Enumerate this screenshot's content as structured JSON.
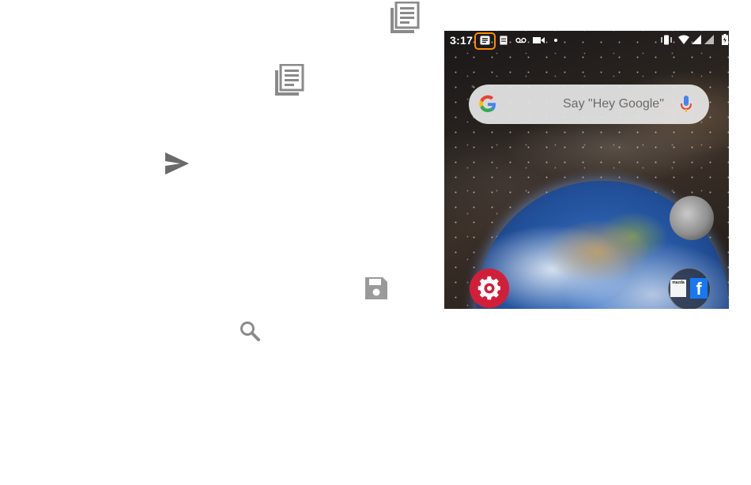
{
  "icons": {
    "reader_top": "article-icon",
    "reader_mid": "article-icon",
    "send": "send-icon",
    "save": "save-icon",
    "search": "search-icon"
  },
  "colors": {
    "icon_gray": "#8a8a8a",
    "highlight_orange": "#ff8a00",
    "settings_red": "#d11f3a"
  },
  "phone": {
    "status": {
      "time": "3:17"
    },
    "search": {
      "hint": "Say \"Hey Google\""
    },
    "apps": {
      "folder_mini_label": "mazda",
      "facebook_letter": "f"
    }
  }
}
